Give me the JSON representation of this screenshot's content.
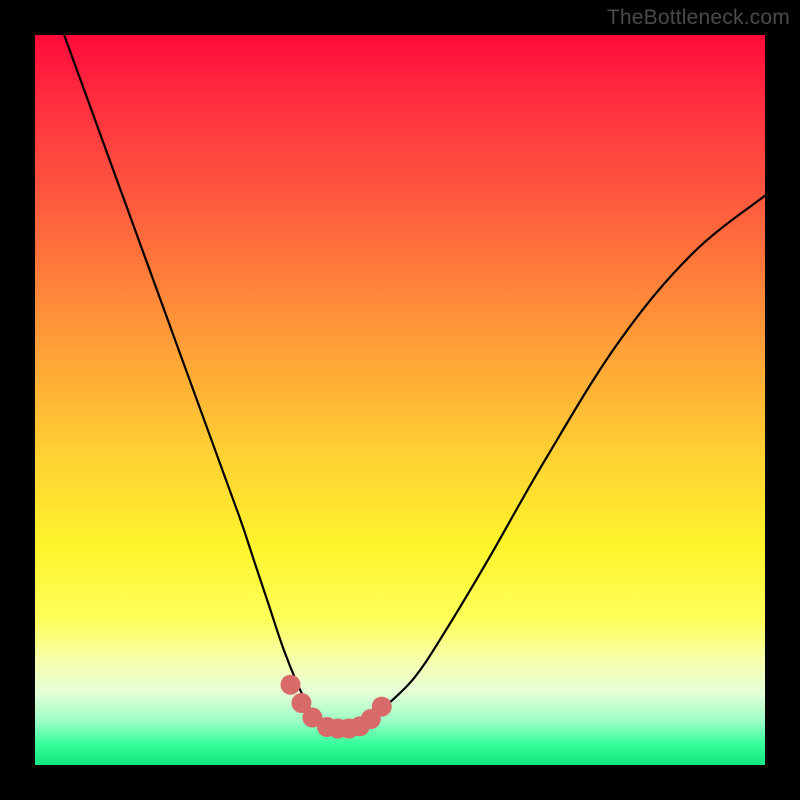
{
  "watermark": "TheBottleneck.com",
  "chart_data": {
    "type": "line",
    "title": "",
    "xlabel": "",
    "ylabel": "",
    "x_range": [
      0,
      100
    ],
    "y_range": [
      0,
      100
    ],
    "series": [
      {
        "name": "bottleneck-curve",
        "x": [
          4,
          8,
          12,
          16,
          20,
          24,
          28,
          30,
          32,
          34,
          36,
          37.5,
          39,
          40.5,
          42,
          44,
          46,
          48,
          52,
          56,
          62,
          70,
          80,
          90,
          100
        ],
        "y": [
          100,
          89,
          78,
          67,
          56,
          45,
          34,
          28,
          22,
          16,
          11,
          8,
          6,
          5,
          5,
          5,
          6,
          8,
          12,
          18,
          28,
          42,
          58,
          70,
          78
        ]
      }
    ],
    "highlight_points": {
      "name": "trough-markers",
      "color": "#d96a6a",
      "x": [
        35,
        36.5,
        38,
        40,
        41.5,
        43,
        44.5,
        46,
        47.5
      ],
      "y": [
        11,
        8.5,
        6.5,
        5.2,
        5,
        5,
        5.3,
        6.3,
        8
      ]
    }
  }
}
